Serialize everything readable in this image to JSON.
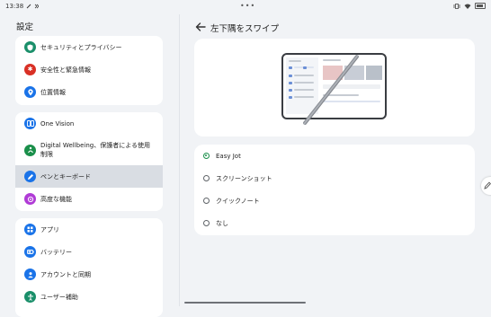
{
  "status": {
    "time": "13:38",
    "center_dots": "•••"
  },
  "left": {
    "title": "設定",
    "groups": [
      {
        "items": [
          {
            "label": "セキュリティとプライバシー",
            "icon": "shield-icon",
            "color": "#1a8f6a"
          },
          {
            "label": "安全性と緊急情報",
            "icon": "asterisk-icon",
            "color": "#d93025"
          },
          {
            "label": "位置情報",
            "icon": "location-pin-icon",
            "color": "#1a73e8"
          }
        ]
      },
      {
        "items": [
          {
            "label": "One Vision",
            "icon": "one-vision-icon",
            "color": "#1a73e8"
          },
          {
            "label": "Digital Wellbeing、保護者による使用制限",
            "icon": "wellbeing-icon",
            "color": "#1a8f4a"
          },
          {
            "label": "ペンとキーボード",
            "icon": "pen-icon",
            "color": "#1a73e8",
            "selected": true
          },
          {
            "label": "高度な機能",
            "icon": "advanced-features-icon",
            "color": "#b03bd6"
          }
        ]
      },
      {
        "items": [
          {
            "label": "アプリ",
            "icon": "apps-grid-icon",
            "color": "#1a73e8"
          },
          {
            "label": "バッテリー",
            "icon": "battery-icon",
            "color": "#1a73e8"
          },
          {
            "label": "アカウントと同期",
            "icon": "account-icon",
            "color": "#1a73e8"
          },
          {
            "label": "ユーザー補助",
            "icon": "accessibility-icon",
            "color": "#1a8f6a"
          }
        ]
      }
    ]
  },
  "right": {
    "title": "左下隅をスワイプ",
    "options": [
      {
        "label": "Easy Jot",
        "selected": true
      },
      {
        "label": "スクリーンショット",
        "selected": false
      },
      {
        "label": "クイックノート",
        "selected": false
      },
      {
        "label": "なし",
        "selected": false
      }
    ]
  }
}
